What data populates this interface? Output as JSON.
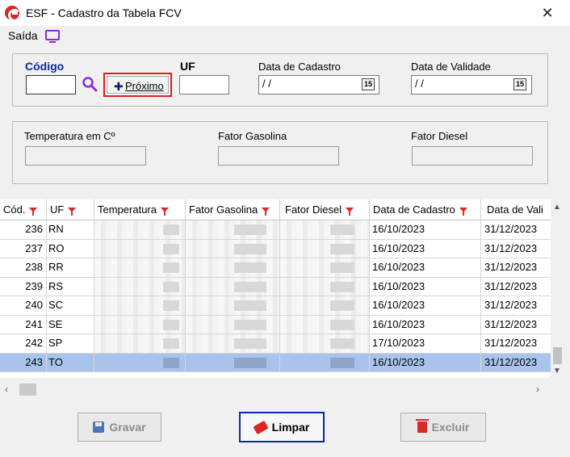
{
  "window": {
    "title": "ESF - Cadastro da Tabela FCV",
    "close_glyph": "✕"
  },
  "menu": {
    "saida_label": "Saída"
  },
  "form": {
    "codigo_label": "Código",
    "codigo_value": "",
    "proximo_label": "Próximo",
    "uf_label": "UF",
    "uf_value": "",
    "data_cadastro_label": "Data de Cadastro",
    "data_cadastro_value": " / /",
    "data_validade_label": "Data de Validade",
    "data_validade_value": " / /",
    "calendar_glyph": "15",
    "temperatura_label": "Temperatura em Cº",
    "fator_gasolina_label": "Fator Gasolina",
    "fator_diesel_label": "Fator Diesel"
  },
  "grid": {
    "headers": [
      "Cód.",
      "UF",
      "Temperatura",
      "Fator Gasolina",
      "Fator Diesel",
      "Data de Cadastro",
      "Data de Vali"
    ],
    "rows": [
      {
        "cod": "236",
        "uf": "RN",
        "cad": "16/10/2023",
        "val": "31/12/2023",
        "selected": false
      },
      {
        "cod": "237",
        "uf": "RO",
        "cad": "16/10/2023",
        "val": "31/12/2023",
        "selected": false
      },
      {
        "cod": "238",
        "uf": "RR",
        "cad": "16/10/2023",
        "val": "31/12/2023",
        "selected": false
      },
      {
        "cod": "239",
        "uf": "RS",
        "cad": "16/10/2023",
        "val": "31/12/2023",
        "selected": false
      },
      {
        "cod": "240",
        "uf": "SC",
        "cad": "16/10/2023",
        "val": "31/12/2023",
        "selected": false
      },
      {
        "cod": "241",
        "uf": "SE",
        "cad": "16/10/2023",
        "val": "31/12/2023",
        "selected": false
      },
      {
        "cod": "242",
        "uf": "SP",
        "cad": "17/10/2023",
        "val": "31/12/2023",
        "selected": false
      },
      {
        "cod": "243",
        "uf": "TO",
        "cad": "16/10/2023",
        "val": "31/12/2023",
        "selected": true
      }
    ]
  },
  "buttons": {
    "gravar": "Gravar",
    "limpar": "Limpar",
    "excluir": "Excluir"
  },
  "colors": {
    "accent_red": "#e01b1b",
    "selection": "#a8c4ec",
    "label_blue": "#0a2a9c",
    "monitor_purple": "#8b2bd9"
  },
  "icons": {
    "logo": "app-logo-icon",
    "close": "close-icon",
    "monitor": "monitor-icon",
    "search": "search-icon",
    "plus": "plus-icon",
    "calendar": "calendar-icon",
    "filter": "filter-icon",
    "save": "save-icon",
    "eraser": "eraser-icon",
    "trash": "trash-icon"
  }
}
